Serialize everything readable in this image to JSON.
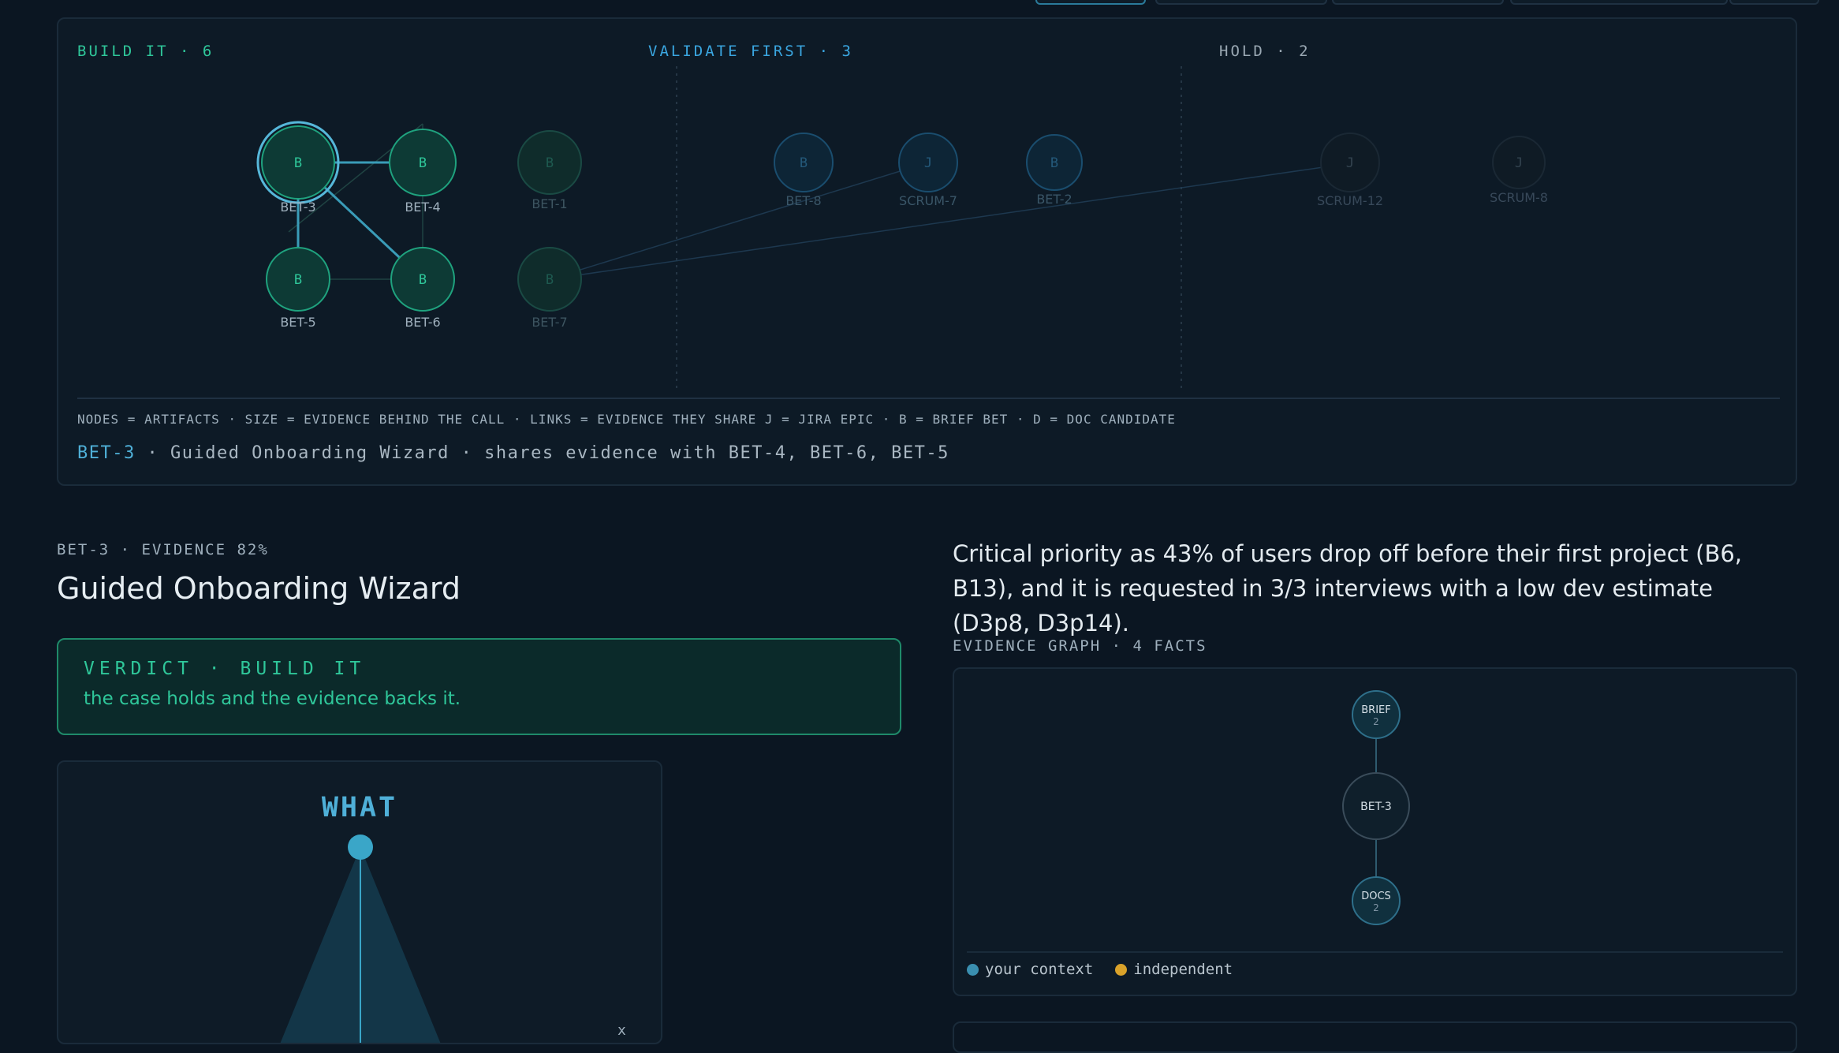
{
  "columns": {
    "build": {
      "label": "BUILD IT · 6",
      "color": "#2fc79a"
    },
    "validate": {
      "label": "VALIDATE FIRST · 3",
      "color": "#3aa6e0"
    },
    "hold": {
      "label": "HOLD · 2",
      "color": "#9aa8b3"
    }
  },
  "nodes": [
    {
      "id": "BET-3",
      "glyph": "B",
      "label": "BET-3",
      "group": "build",
      "selected": true
    },
    {
      "id": "BET-4",
      "glyph": "B",
      "label": "BET-4",
      "group": "build"
    },
    {
      "id": "BET-1",
      "glyph": "B",
      "label": "BET-1",
      "group": "build",
      "dim": true
    },
    {
      "id": "BET-5",
      "glyph": "B",
      "label": "BET-5",
      "group": "build"
    },
    {
      "id": "BET-6",
      "glyph": "B",
      "label": "BET-6",
      "group": "build"
    },
    {
      "id": "BET-7",
      "glyph": "B",
      "label": "BET-7",
      "group": "build",
      "dim": true
    },
    {
      "id": "BET-8",
      "glyph": "B",
      "label": "BET-8",
      "group": "validate"
    },
    {
      "id": "SCRUM-7",
      "glyph": "J",
      "label": "SCRUM-7",
      "group": "validate"
    },
    {
      "id": "BET-2",
      "glyph": "B",
      "label": "BET-2",
      "group": "validate"
    },
    {
      "id": "SCRUM-12",
      "glyph": "J",
      "label": "SCRUM-12",
      "group": "hold"
    },
    {
      "id": "SCRUM-8",
      "glyph": "J",
      "label": "SCRUM-8",
      "group": "hold"
    }
  ],
  "legend": "NODES = ARTIFACTS · SIZE = EVIDENCE BEHIND THE CALL · LINKS = EVIDENCE THEY SHARE   J = JIRA EPIC · B = BRIEF BET · D = DOC CANDIDATE",
  "selection": {
    "id": "BET-3",
    "text": " · Guided Onboarding Wizard · shares evidence with BET-4, BET-6, BET-5"
  },
  "detail": {
    "meta": "BET-3 · EVIDENCE 82%",
    "title": "Guided Onboarding Wizard",
    "verdict_label": "VERDICT · BUILD IT",
    "verdict_text": "the case holds and the evidence backs it.",
    "what_label": "WHAT",
    "reason": "Critical priority as 43% of users drop off before their first project (B6, B13), and it is requested in 3/3 interviews with a low dev estimate (D3p8, D3p14)."
  },
  "evidence_graph": {
    "label": "EVIDENCE GRAPH · 4 FACTS",
    "nodes": [
      {
        "label": "BRIEF",
        "count": "2"
      },
      {
        "label": "BET-3",
        "count": ""
      },
      {
        "label": "DOCS",
        "count": "2"
      }
    ],
    "legend": [
      {
        "label": "your context",
        "color": "#3a8fb0"
      },
      {
        "label": "independent",
        "color": "#d9a22a"
      }
    ]
  }
}
